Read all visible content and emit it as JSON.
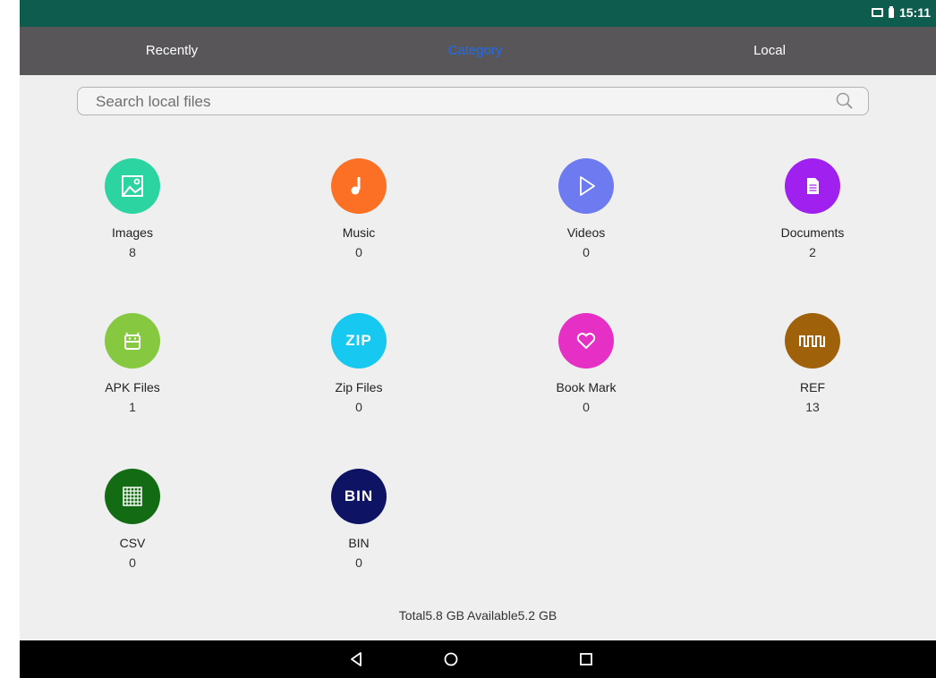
{
  "status_bar": {
    "time": "15:11",
    "icons": [
      "cast-icon",
      "battery-icon"
    ]
  },
  "tabs": [
    {
      "label": "Recently",
      "active": false
    },
    {
      "label": "Category",
      "active": true
    },
    {
      "label": "Local",
      "active": false
    }
  ],
  "search": {
    "placeholder": "Search local files",
    "value": ""
  },
  "categories": [
    {
      "label": "Images",
      "count": "8",
      "color": "#2bd4a0",
      "icon": "image-icon"
    },
    {
      "label": "Music",
      "count": "0",
      "color": "#fb7024",
      "icon": "music-note-icon"
    },
    {
      "label": "Videos",
      "count": "0",
      "color": "#6e7af0",
      "icon": "play-icon"
    },
    {
      "label": "Documents",
      "count": "2",
      "color": "#a020f0",
      "icon": "document-icon"
    },
    {
      "label": "APK Files",
      "count": "1",
      "color": "#86c940",
      "icon": "android-icon"
    },
    {
      "label": "Zip Files",
      "count": "0",
      "color": "#17c9f0",
      "icon": "zip-icon",
      "icon_text": "ZIP"
    },
    {
      "label": "Book Mark",
      "count": "0",
      "color": "#e62fc4",
      "icon": "heart-icon"
    },
    {
      "label": "REF",
      "count": "13",
      "color": "#a0610b",
      "icon": "waveform-icon"
    },
    {
      "label": "CSV",
      "count": "0",
      "color": "#136b13",
      "icon": "grid-icon"
    },
    {
      "label": "BIN",
      "count": "0",
      "color": "#0e1363",
      "icon": "bin-icon",
      "icon_text": "BIN"
    }
  ],
  "storage_text": "Total5.8 GB Available5.2 GB",
  "nav": [
    "back-icon",
    "home-icon",
    "recents-icon"
  ]
}
